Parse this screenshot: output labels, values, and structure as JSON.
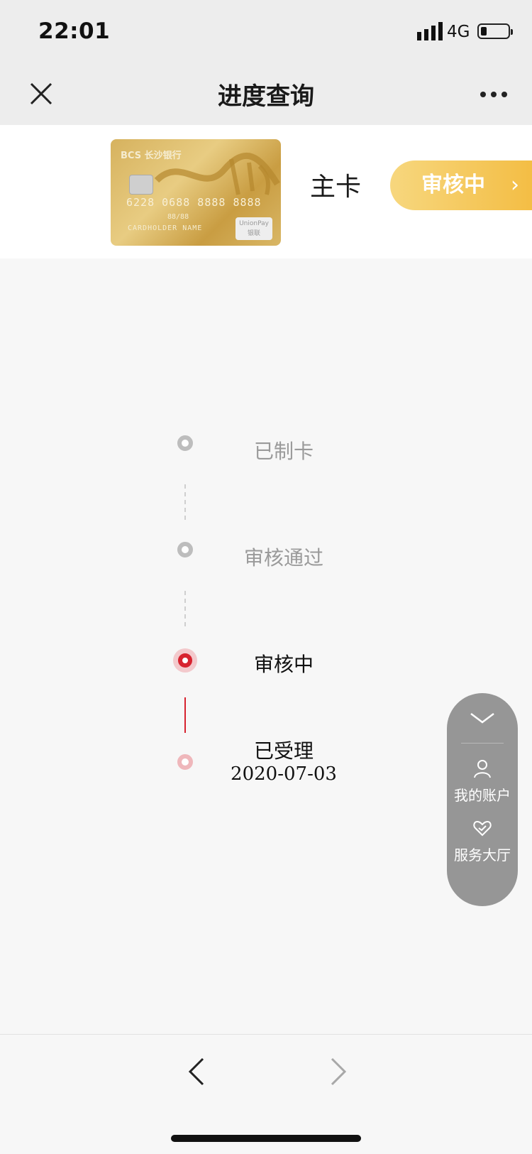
{
  "status_bar": {
    "time": "22:01",
    "network": "4G"
  },
  "nav": {
    "title": "进度查询"
  },
  "card": {
    "brand": "BCS 长沙银行",
    "number": "6228 0688 8888 8888",
    "valid": "88/88",
    "holder": "CARDHOLDER NAME",
    "network_logo": "UnionPay 银联",
    "type_label": "主卡",
    "status_label": "审核中"
  },
  "timeline": [
    {
      "label": "已制卡",
      "state": "done"
    },
    {
      "label": "审核通过",
      "state": "done"
    },
    {
      "label": "审核中",
      "state": "current"
    },
    {
      "label": "已受理",
      "date": "2020-07-03",
      "state": "accepted"
    }
  ],
  "float_panel": {
    "account_label": "我的账户",
    "service_label": "服务大厅"
  },
  "colors": {
    "accent_red": "#d7232f",
    "pill_gold": "#f3bb3f"
  }
}
